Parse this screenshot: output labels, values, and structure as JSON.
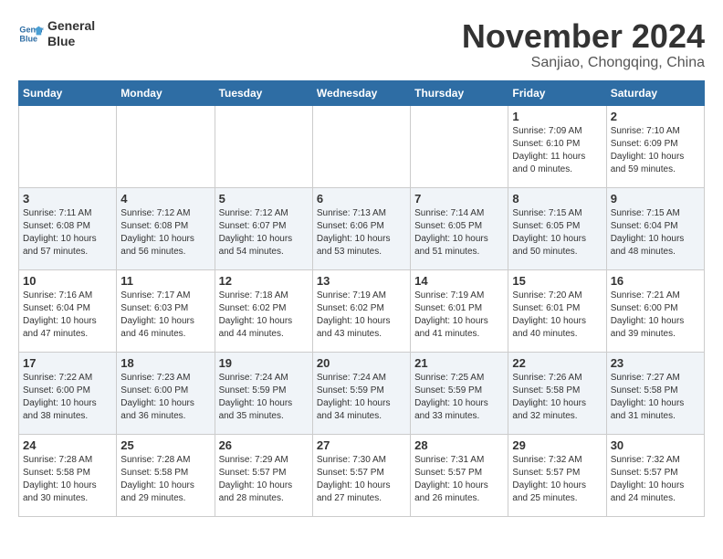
{
  "header": {
    "logo_line1": "General",
    "logo_line2": "Blue",
    "month": "November 2024",
    "location": "Sanjiao, Chongqing, China"
  },
  "weekdays": [
    "Sunday",
    "Monday",
    "Tuesday",
    "Wednesday",
    "Thursday",
    "Friday",
    "Saturday"
  ],
  "weeks": [
    [
      {
        "day": "",
        "info": ""
      },
      {
        "day": "",
        "info": ""
      },
      {
        "day": "",
        "info": ""
      },
      {
        "day": "",
        "info": ""
      },
      {
        "day": "",
        "info": ""
      },
      {
        "day": "1",
        "info": "Sunrise: 7:09 AM\nSunset: 6:10 PM\nDaylight: 11 hours\nand 0 minutes."
      },
      {
        "day": "2",
        "info": "Sunrise: 7:10 AM\nSunset: 6:09 PM\nDaylight: 10 hours\nand 59 minutes."
      }
    ],
    [
      {
        "day": "3",
        "info": "Sunrise: 7:11 AM\nSunset: 6:08 PM\nDaylight: 10 hours\nand 57 minutes."
      },
      {
        "day": "4",
        "info": "Sunrise: 7:12 AM\nSunset: 6:08 PM\nDaylight: 10 hours\nand 56 minutes."
      },
      {
        "day": "5",
        "info": "Sunrise: 7:12 AM\nSunset: 6:07 PM\nDaylight: 10 hours\nand 54 minutes."
      },
      {
        "day": "6",
        "info": "Sunrise: 7:13 AM\nSunset: 6:06 PM\nDaylight: 10 hours\nand 53 minutes."
      },
      {
        "day": "7",
        "info": "Sunrise: 7:14 AM\nSunset: 6:05 PM\nDaylight: 10 hours\nand 51 minutes."
      },
      {
        "day": "8",
        "info": "Sunrise: 7:15 AM\nSunset: 6:05 PM\nDaylight: 10 hours\nand 50 minutes."
      },
      {
        "day": "9",
        "info": "Sunrise: 7:15 AM\nSunset: 6:04 PM\nDaylight: 10 hours\nand 48 minutes."
      }
    ],
    [
      {
        "day": "10",
        "info": "Sunrise: 7:16 AM\nSunset: 6:04 PM\nDaylight: 10 hours\nand 47 minutes."
      },
      {
        "day": "11",
        "info": "Sunrise: 7:17 AM\nSunset: 6:03 PM\nDaylight: 10 hours\nand 46 minutes."
      },
      {
        "day": "12",
        "info": "Sunrise: 7:18 AM\nSunset: 6:02 PM\nDaylight: 10 hours\nand 44 minutes."
      },
      {
        "day": "13",
        "info": "Sunrise: 7:19 AM\nSunset: 6:02 PM\nDaylight: 10 hours\nand 43 minutes."
      },
      {
        "day": "14",
        "info": "Sunrise: 7:19 AM\nSunset: 6:01 PM\nDaylight: 10 hours\nand 41 minutes."
      },
      {
        "day": "15",
        "info": "Sunrise: 7:20 AM\nSunset: 6:01 PM\nDaylight: 10 hours\nand 40 minutes."
      },
      {
        "day": "16",
        "info": "Sunrise: 7:21 AM\nSunset: 6:00 PM\nDaylight: 10 hours\nand 39 minutes."
      }
    ],
    [
      {
        "day": "17",
        "info": "Sunrise: 7:22 AM\nSunset: 6:00 PM\nDaylight: 10 hours\nand 38 minutes."
      },
      {
        "day": "18",
        "info": "Sunrise: 7:23 AM\nSunset: 6:00 PM\nDaylight: 10 hours\nand 36 minutes."
      },
      {
        "day": "19",
        "info": "Sunrise: 7:24 AM\nSunset: 5:59 PM\nDaylight: 10 hours\nand 35 minutes."
      },
      {
        "day": "20",
        "info": "Sunrise: 7:24 AM\nSunset: 5:59 PM\nDaylight: 10 hours\nand 34 minutes."
      },
      {
        "day": "21",
        "info": "Sunrise: 7:25 AM\nSunset: 5:59 PM\nDaylight: 10 hours\nand 33 minutes."
      },
      {
        "day": "22",
        "info": "Sunrise: 7:26 AM\nSunset: 5:58 PM\nDaylight: 10 hours\nand 32 minutes."
      },
      {
        "day": "23",
        "info": "Sunrise: 7:27 AM\nSunset: 5:58 PM\nDaylight: 10 hours\nand 31 minutes."
      }
    ],
    [
      {
        "day": "24",
        "info": "Sunrise: 7:28 AM\nSunset: 5:58 PM\nDaylight: 10 hours\nand 30 minutes."
      },
      {
        "day": "25",
        "info": "Sunrise: 7:28 AM\nSunset: 5:58 PM\nDaylight: 10 hours\nand 29 minutes."
      },
      {
        "day": "26",
        "info": "Sunrise: 7:29 AM\nSunset: 5:57 PM\nDaylight: 10 hours\nand 28 minutes."
      },
      {
        "day": "27",
        "info": "Sunrise: 7:30 AM\nSunset: 5:57 PM\nDaylight: 10 hours\nand 27 minutes."
      },
      {
        "day": "28",
        "info": "Sunrise: 7:31 AM\nSunset: 5:57 PM\nDaylight: 10 hours\nand 26 minutes."
      },
      {
        "day": "29",
        "info": "Sunrise: 7:32 AM\nSunset: 5:57 PM\nDaylight: 10 hours\nand 25 minutes."
      },
      {
        "day": "30",
        "info": "Sunrise: 7:32 AM\nSunset: 5:57 PM\nDaylight: 10 hours\nand 24 minutes."
      }
    ]
  ]
}
